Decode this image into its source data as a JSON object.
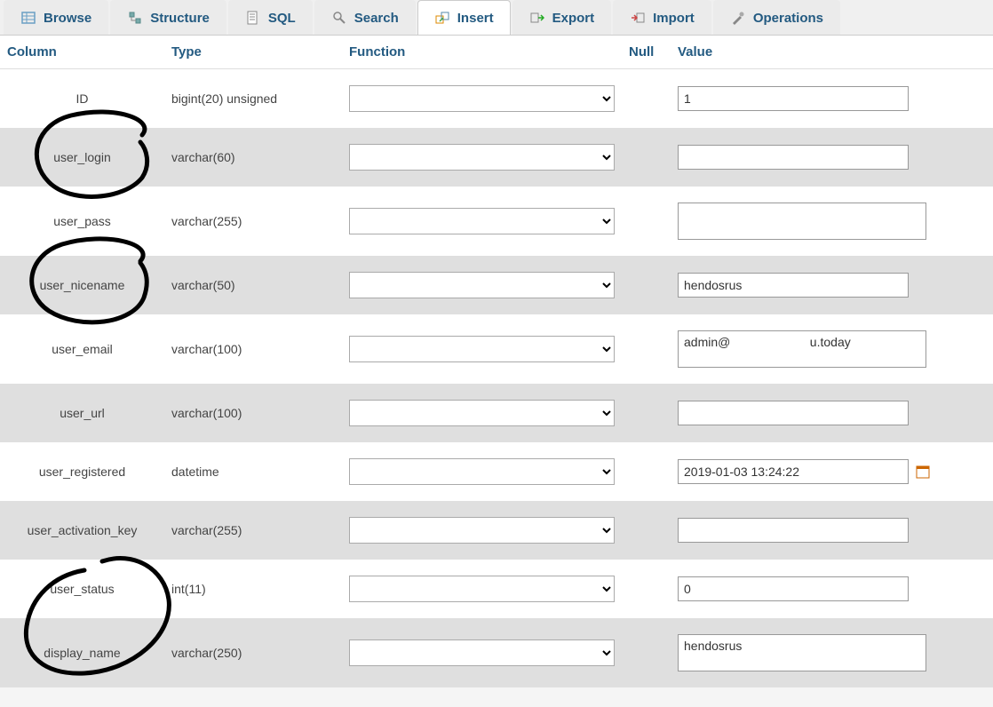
{
  "tabs": [
    {
      "label": "Browse",
      "active": false
    },
    {
      "label": "Structure",
      "active": false
    },
    {
      "label": "SQL",
      "active": false
    },
    {
      "label": "Search",
      "active": false
    },
    {
      "label": "Insert",
      "active": true
    },
    {
      "label": "Export",
      "active": false
    },
    {
      "label": "Import",
      "active": false
    },
    {
      "label": "Operations",
      "active": false
    }
  ],
  "headers": {
    "column": "Column",
    "type": "Type",
    "function": "Function",
    "null": "Null",
    "value": "Value"
  },
  "rows": [
    {
      "column": "ID",
      "type": "bigint(20) unsigned",
      "value": "1",
      "input": "short"
    },
    {
      "column": "user_login",
      "type": "varchar(60)",
      "value": "",
      "input": "short",
      "circled": true
    },
    {
      "column": "user_pass",
      "type": "varchar(255)",
      "value": "",
      "input": "wide"
    },
    {
      "column": "user_nicename",
      "type": "varchar(50)",
      "value": "hendosrus",
      "input": "short",
      "circled": true
    },
    {
      "column": "user_email",
      "type": "varchar(100)",
      "value": "admin@                       u.today",
      "input": "wide"
    },
    {
      "column": "user_url",
      "type": "varchar(100)",
      "value": "",
      "input": "short"
    },
    {
      "column": "user_registered",
      "type": "datetime",
      "value": "2019-01-03 13:24:22",
      "input": "date"
    },
    {
      "column": "user_activation_key",
      "type": "varchar(255)",
      "value": "",
      "input": "short"
    },
    {
      "column": "user_status",
      "type": "int(11)",
      "value": "0",
      "input": "short"
    },
    {
      "column": "display_name",
      "type": "varchar(250)",
      "value": "hendosrus",
      "input": "wide",
      "circled": true
    }
  ]
}
